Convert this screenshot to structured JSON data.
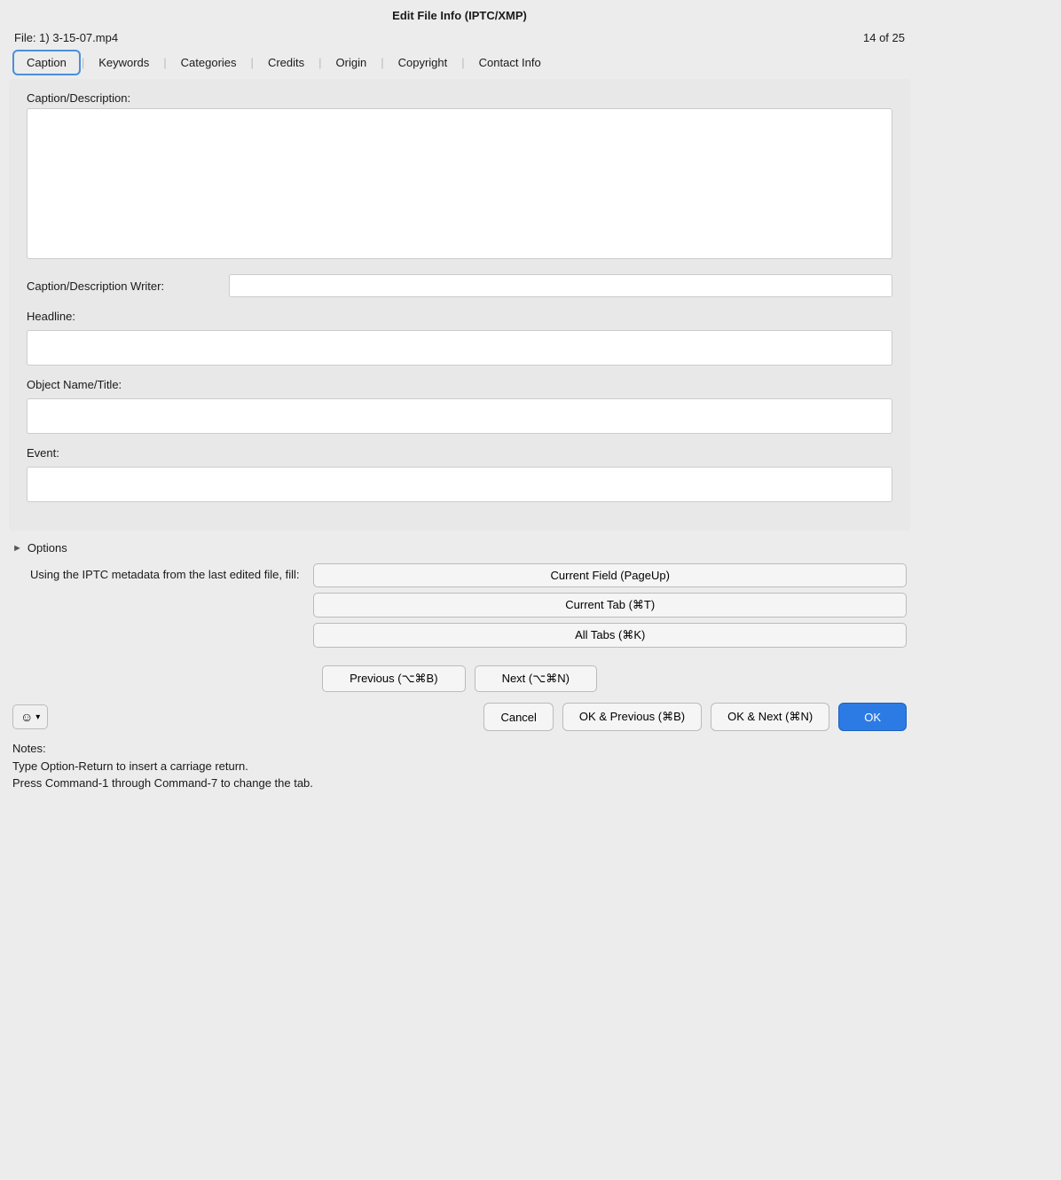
{
  "titleBar": {
    "title": "Edit File Info (IPTC/XMP)"
  },
  "fileInfo": {
    "filename": "File: 1) 3-15-07.mp4",
    "position": "14 of 25"
  },
  "tabs": [
    {
      "id": "caption",
      "label": "Caption",
      "active": true
    },
    {
      "id": "keywords",
      "label": "Keywords",
      "active": false
    },
    {
      "id": "categories",
      "label": "Categories",
      "active": false
    },
    {
      "id": "credits",
      "label": "Credits",
      "active": false
    },
    {
      "id": "origin",
      "label": "Origin",
      "active": false
    },
    {
      "id": "copyright",
      "label": "Copyright",
      "active": false
    },
    {
      "id": "contact-info",
      "label": "Contact Info",
      "active": false
    }
  ],
  "fields": {
    "captionLabel": "Caption/Description:",
    "captionWriterLabel": "Caption/Description Writer:",
    "headlineLabel": "Headline:",
    "objectNameLabel": "Object Name/Title:",
    "eventLabel": "Event:"
  },
  "options": {
    "header": "Options",
    "promptLabel": "Using the IPTC metadata from the last edited file, fill:",
    "buttons": [
      "Current Field (PageUp)",
      "Current Tab (⌘T)",
      "All Tabs (⌘K)"
    ]
  },
  "navigation": {
    "previous": "Previous (⌥⌘B)",
    "next": "Next (⌥⌘N)"
  },
  "bottomBar": {
    "emoji": "☺",
    "chevron": "▾",
    "cancel": "Cancel",
    "okPrev": "OK & Previous (⌘B)",
    "okNext": "OK & Next (⌘N)",
    "ok": "OK"
  },
  "notes": {
    "line1": "Notes:",
    "line2": "Type Option-Return to insert a carriage return.",
    "line3": "Press Command-1 through Command-7 to change the tab."
  }
}
